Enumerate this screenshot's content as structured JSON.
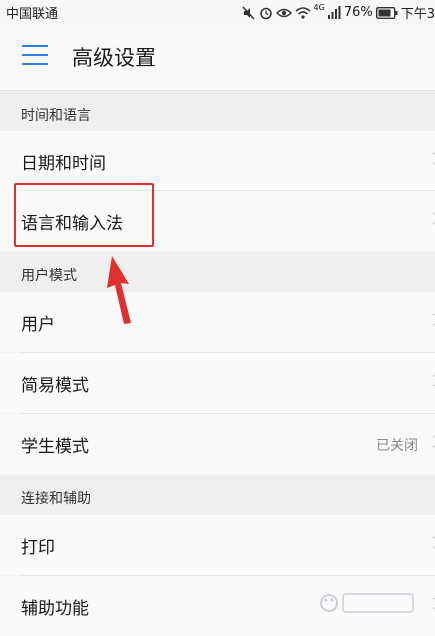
{
  "status_bar": {
    "carrier": "中国联通",
    "network": "4G",
    "battery": "76%",
    "time": "下午3"
  },
  "app_bar": {
    "title": "高级设置"
  },
  "sections": [
    {
      "header": "时间和语言",
      "items": [
        {
          "label": "日期和时间"
        },
        {
          "label": "语言和输入法"
        }
      ]
    },
    {
      "header": "用户模式",
      "items": [
        {
          "label": "用户"
        },
        {
          "label": "简易模式"
        },
        {
          "label": "学生模式",
          "value": "已关闭"
        }
      ]
    },
    {
      "header": "连接和辅助",
      "items": [
        {
          "label": "打印"
        },
        {
          "label": "辅助功能"
        }
      ]
    }
  ],
  "colors": {
    "accent": "#2e7df6",
    "annotation": "#e03030",
    "background": "#f2f2f2",
    "row_background": "#fafafa"
  }
}
